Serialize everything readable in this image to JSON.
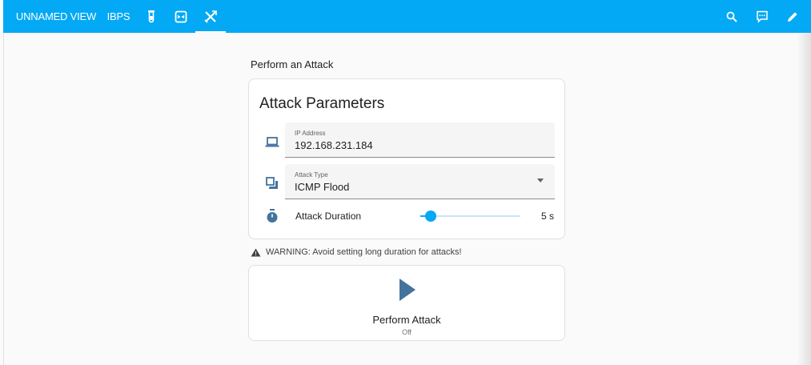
{
  "topbar": {
    "tabs": [
      {
        "label": "UNNAMED VIEW"
      },
      {
        "label": "IBPS"
      }
    ],
    "icon_tabs": [
      "test-tube-icon",
      "scan-icon",
      "tools-icon"
    ],
    "actions": [
      "search-icon",
      "comment-icon",
      "pencil-icon"
    ],
    "color": "#03a9f4"
  },
  "section": {
    "title": "Perform an Attack"
  },
  "params": {
    "title": "Attack Parameters",
    "ip": {
      "label": "IP Address",
      "value": "192.168.231.184",
      "icon": "laptop-icon"
    },
    "type": {
      "label": "Attack Type",
      "value": "ICMP Flood",
      "icon": "layers-icon"
    },
    "duration": {
      "label": "Attack Duration",
      "value_text": "5 s",
      "slider_fraction": 0.1,
      "icon": "timer-icon"
    }
  },
  "warning": {
    "text": "WARNING: Avoid setting long duration for attacks!",
    "icon": "alert-icon"
  },
  "attack_button": {
    "name": "Perform Attack",
    "state": "Off",
    "icon": "play-icon",
    "icon_color": "#44739e"
  }
}
